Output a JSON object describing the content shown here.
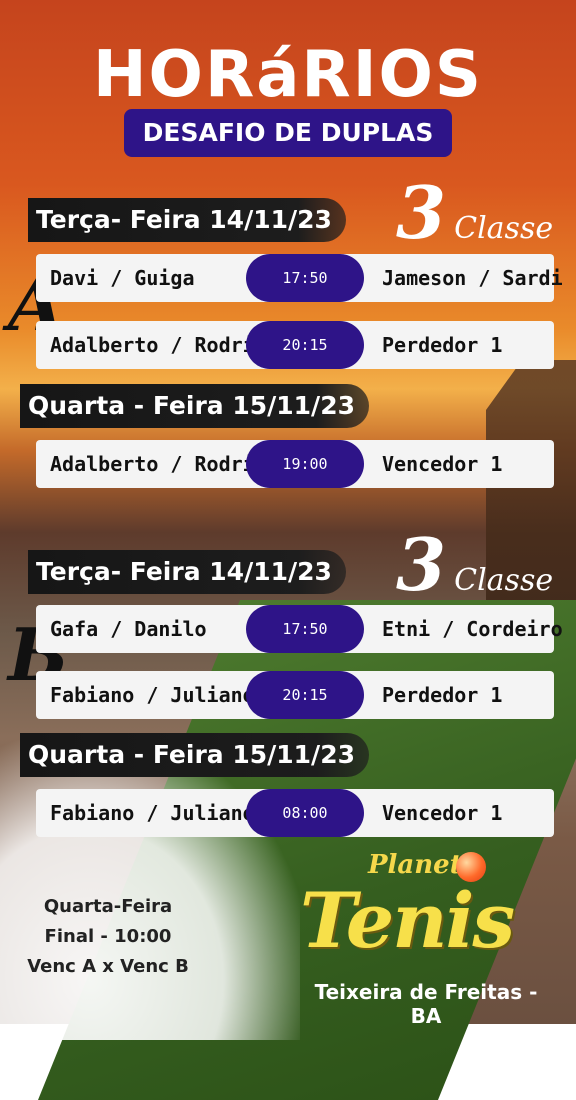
{
  "header": {
    "title": "HORáRIOS",
    "subtitle": "DESAFIO DE DUPLAS"
  },
  "group_a": {
    "label": "A",
    "classe_num": "3",
    "classe_label": "Classe",
    "day1": "Terça- Feira 14/11/23",
    "day2": "Quarta - Feira 15/11/23",
    "matches": [
      {
        "team1": "Davi / Guiga",
        "time": "17:50",
        "team2": "Jameson / Sardi"
      },
      {
        "team1": "Adalberto / Rodrigo",
        "time": "20:15",
        "team2": "Perdedor 1"
      },
      {
        "team1": "Adalberto / Rodrigo",
        "time": "19:00",
        "team2": "Vencedor 1"
      }
    ]
  },
  "group_b": {
    "label": "B",
    "classe_num": "3",
    "classe_label": "Classe",
    "day1": "Terça- Feira 14/11/23",
    "day2": "Quarta - Feira 15/11/23",
    "matches": [
      {
        "team1": "Gafa / Danilo",
        "time": "17:50",
        "team2": "Etni / Cordeiro"
      },
      {
        "team1": "Fabiano / Juliano",
        "time": "20:15",
        "team2": "Perdedor 1"
      },
      {
        "team1": "Fabiano / Juliano",
        "time": "08:00",
        "team2": "Vencedor 1"
      }
    ]
  },
  "final": {
    "line1": "Quarta-Feira",
    "line2": "Final - 10:00",
    "line3": "Venc A x Venc B"
  },
  "brand": {
    "planeta": "Planeta",
    "tenis": "Tenis",
    "city": "Teixeira de Freitas - BA"
  }
}
